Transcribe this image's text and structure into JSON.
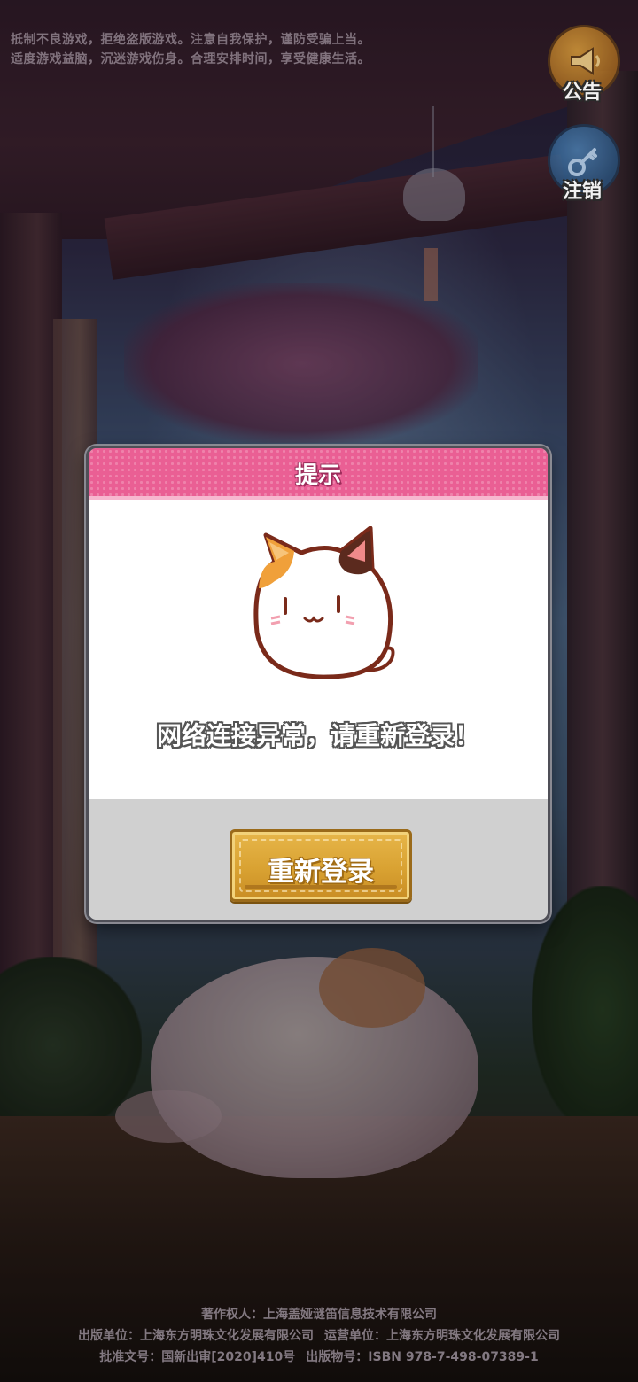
{
  "warning": {
    "line1": "抵制不良游戏，拒绝盗版游戏。注意自我保护，谨防受骗上当。",
    "line2": "适度游戏益脑，沉迷游戏伤身。合理安排时间，享受健康生活。"
  },
  "side_buttons": {
    "notice": {
      "label": "公告",
      "icon": "megaphone-icon"
    },
    "logout": {
      "label": "注销",
      "icon": "key-icon"
    }
  },
  "dialog": {
    "title": "提示",
    "message": "网络连接异常，请重新登录！",
    "button_label": "重新登录",
    "header_color": "#ea5f94",
    "button_color": "#d9a232"
  },
  "footer": {
    "copyright": "著作权人：上海盖娅谜笛信息技术有限公司",
    "publisher": "出版单位：上海东方明珠文化发展有限公司",
    "operator": "运营单位：上海东方明珠文化发展有限公司",
    "approval": "批准文号：国新出审[2020]410号",
    "isbn": "出版物号：ISBN 978-7-498-07389-1"
  }
}
